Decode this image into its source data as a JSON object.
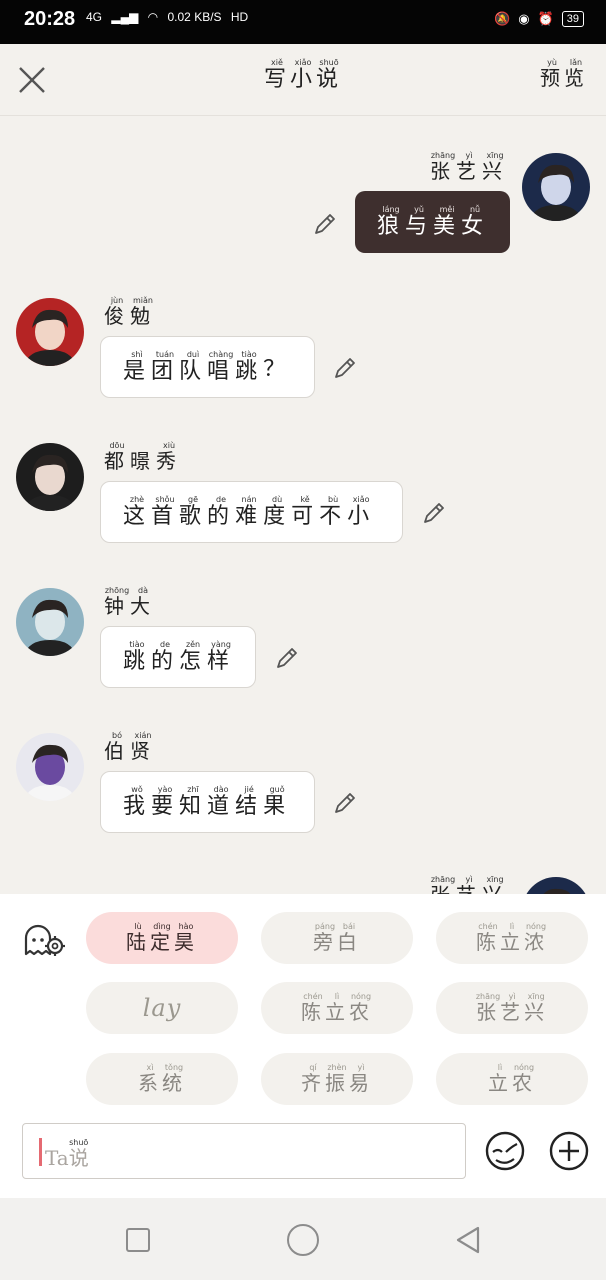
{
  "status_bar": {
    "time": "20:28",
    "network": "4G",
    "speed": "0.02 KB/S",
    "hd": "HD",
    "battery": "39"
  },
  "header": {
    "title_chars": [
      [
        "写",
        "xiě"
      ],
      [
        "小",
        "xiǎo"
      ],
      [
        "说",
        "shuō"
      ]
    ],
    "preview_chars": [
      [
        "预",
        "yù"
      ],
      [
        "览",
        "lǎn"
      ]
    ]
  },
  "messages": [
    {
      "side": "right",
      "name": [
        [
          "张",
          "zhāng"
        ],
        [
          "艺",
          "yì"
        ],
        [
          "兴",
          "xīng"
        ]
      ],
      "text": [
        [
          "狼",
          "láng"
        ],
        [
          "与",
          "yǔ"
        ],
        [
          "美",
          "měi"
        ],
        [
          "女",
          "nǚ"
        ]
      ],
      "style": "dark",
      "avatar": "avatar-zhang-yixing"
    },
    {
      "side": "left",
      "name": [
        [
          "俊",
          "jùn"
        ],
        [
          "勉",
          "miǎn"
        ]
      ],
      "text": [
        [
          "是",
          "shì"
        ],
        [
          "团",
          "tuán"
        ],
        [
          "队",
          "duì"
        ],
        [
          "唱",
          "chàng"
        ],
        [
          "跳",
          "tiào"
        ],
        [
          "？",
          ""
        ]
      ],
      "style": "light",
      "avatar": "avatar-junmian"
    },
    {
      "side": "left",
      "name": [
        [
          "都",
          "dōu"
        ],
        [
          "暻",
          ""
        ],
        [
          "秀",
          "xiù"
        ]
      ],
      "text": [
        [
          "这",
          "zhè"
        ],
        [
          "首",
          "shǒu"
        ],
        [
          "歌",
          "gē"
        ],
        [
          "的",
          "de"
        ],
        [
          "难",
          "nán"
        ],
        [
          "度",
          "dù"
        ],
        [
          "可",
          "kě"
        ],
        [
          "不",
          "bù"
        ],
        [
          "小",
          "xiǎo"
        ]
      ],
      "style": "light",
      "avatar": "avatar-dujingxiu"
    },
    {
      "side": "left",
      "name": [
        [
          "钟",
          "zhōng"
        ],
        [
          "大",
          "dà"
        ]
      ],
      "text": [
        [
          "跳",
          "tiào"
        ],
        [
          "的",
          "de"
        ],
        [
          "怎",
          "zěn"
        ],
        [
          "样",
          "yàng"
        ]
      ],
      "style": "light",
      "avatar": "avatar-zhongda"
    },
    {
      "side": "left",
      "name": [
        [
          "伯",
          "bó"
        ],
        [
          "贤",
          "xián"
        ]
      ],
      "text": [
        [
          "我",
          "wǒ"
        ],
        [
          "要",
          "yào"
        ],
        [
          "知",
          "zhī"
        ],
        [
          "道",
          "dào"
        ],
        [
          "结",
          "jié"
        ],
        [
          "果",
          "guǒ"
        ]
      ],
      "style": "light",
      "avatar": "avatar-boxian"
    },
    {
      "side": "right",
      "name": [
        [
          "张",
          "zhāng"
        ],
        [
          "艺",
          "yì"
        ],
        [
          "兴",
          "xīng"
        ]
      ],
      "partial": true,
      "avatar": "avatar-zhang-yixing"
    }
  ],
  "roles": [
    {
      "label": [
        [
          "陆",
          "lù"
        ],
        [
          "定",
          "dìng"
        ],
        [
          "昊",
          "hào"
        ]
      ],
      "active": true
    },
    {
      "label": [
        [
          "旁",
          "páng"
        ],
        [
          "白",
          "bái"
        ]
      ],
      "active": false
    },
    {
      "label": [
        [
          "陈",
          "chén"
        ],
        [
          "立",
          "lì"
        ],
        [
          "浓",
          "nóng"
        ]
      ],
      "active": false
    },
    {
      "label_plain": "lay",
      "active": false
    },
    {
      "label": [
        [
          "陈",
          "chén"
        ],
        [
          "立",
          "lì"
        ],
        [
          "农",
          "nóng"
        ]
      ],
      "active": false
    },
    {
      "label": [
        [
          "张",
          "zhāng"
        ],
        [
          "艺",
          "yì"
        ],
        [
          "兴",
          "xīng"
        ]
      ],
      "active": false
    },
    {
      "label": [
        [
          "系",
          "xì"
        ],
        [
          "统",
          "tǒng"
        ]
      ],
      "active": false
    },
    {
      "label": [
        [
          "齐",
          "qí"
        ],
        [
          "振",
          "zhèn"
        ],
        [
          "易",
          "yì"
        ]
      ],
      "active": false
    },
    {
      "label": [
        [
          "立",
          "lì"
        ],
        [
          "农",
          "nóng"
        ]
      ],
      "active": false
    }
  ],
  "input": {
    "placeholder_prefix": "Ta",
    "placeholder_char": [
      [
        "说",
        "shuō"
      ]
    ]
  },
  "icons": {
    "close": "close-icon",
    "edit": "pencil-icon",
    "settings": "role-settings-icon",
    "emoji": "emoji-icon",
    "plus": "plus-icon",
    "nav_recent": "square-icon",
    "nav_home": "circle-icon",
    "nav_back": "triangle-back-icon"
  },
  "colors": {
    "accent_bubble": "#3e2f2e",
    "active_role": "#fbdcdb",
    "caret": "#e56a72"
  }
}
